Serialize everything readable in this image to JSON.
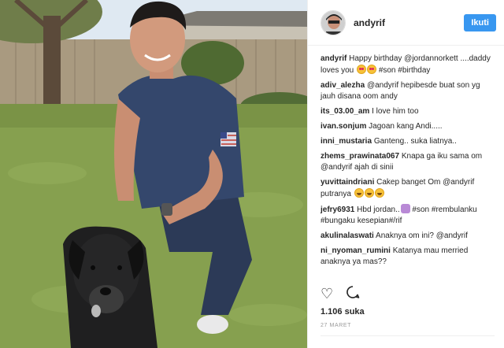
{
  "post": {
    "username": "andyrif",
    "follow_label": "Ikuti",
    "likes": "1.106 suka",
    "date": "27 MARET"
  },
  "comments": [
    {
      "user": "andyrif",
      "parts": [
        {
          "t": "Happy birthday "
        },
        {
          "t": "@jordannorkett",
          "blue": true
        },
        {
          "t": " ....daddy loves you "
        },
        {
          "emoji": "love"
        },
        {
          "emoji": "love"
        },
        {
          "t": " "
        },
        {
          "t": "#son",
          "blue": true
        },
        {
          "t": " "
        },
        {
          "t": "#birthday",
          "blue": true
        }
      ]
    },
    {
      "user": "adiv_alezha",
      "parts": [
        {
          "t": "@andyrif",
          "blue": true
        },
        {
          "t": " hepibesde buat son yg jauh disana oom andy"
        }
      ]
    },
    {
      "user": "its_03.00_am",
      "parts": [
        {
          "t": "I love him too"
        }
      ]
    },
    {
      "user": "ivan.sonjum",
      "parts": [
        {
          "t": "Jagoan kang Andi....."
        }
      ]
    },
    {
      "user": "inni_mustaria",
      "parts": [
        {
          "t": "Ganteng.. suka liatnya.."
        }
      ]
    },
    {
      "user": "zhems_prawinata067",
      "parts": [
        {
          "t": "Knapa ga iku sama om "
        },
        {
          "t": "@andyrif",
          "blue": true
        },
        {
          "t": " ajah di sinii"
        }
      ]
    },
    {
      "user": "yuvittaindriani",
      "parts": [
        {
          "t": "Cakep banget Om "
        },
        {
          "t": "@andyrif",
          "blue": true
        },
        {
          "t": " putranya "
        },
        {
          "emoji": "grin"
        },
        {
          "emoji": "grin"
        },
        {
          "emoji": "grin"
        }
      ]
    },
    {
      "user": "jefry6931",
      "parts": [
        {
          "t": "Hbd jordan.."
        },
        {
          "emoji": "person"
        },
        {
          "t": " "
        },
        {
          "t": "#son",
          "blue": true
        },
        {
          "t": " "
        },
        {
          "t": "#rembulanku",
          "blue": true
        },
        {
          "t": " "
        },
        {
          "t": "#bungaku",
          "blue": true
        },
        {
          "t": " kesepian#/rif"
        }
      ]
    },
    {
      "user": "akulinalaswati",
      "parts": [
        {
          "t": "Anaknya om ini? "
        },
        {
          "t": "@andyrif",
          "blue": true
        }
      ]
    },
    {
      "user": "ni_nyoman_rumini",
      "parts": [
        {
          "t": "Katanya mau merried anaknya ya mas??"
        }
      ]
    }
  ],
  "icons": {
    "like": "heart-icon",
    "comment": "comment-icon"
  },
  "colors": {
    "follow": "#3897f0",
    "link": "#003569",
    "text": "#262626",
    "muted": "#999999"
  }
}
